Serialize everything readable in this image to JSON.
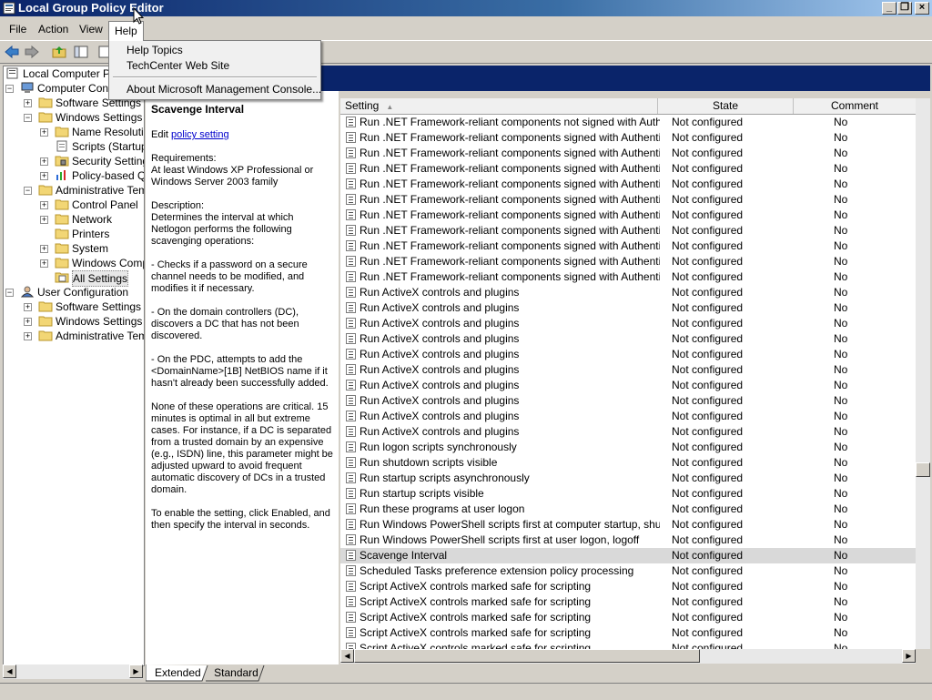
{
  "window": {
    "title": "Local Group Policy Editor"
  },
  "menubar": [
    {
      "label": "File"
    },
    {
      "label": "Action"
    },
    {
      "label": "View"
    },
    {
      "label": "Help"
    }
  ],
  "help_menu": {
    "items": [
      "Help Topics",
      "TechCenter Web Site"
    ],
    "about": "About Microsoft Management Console..."
  },
  "tree": [
    {
      "label": "Local Computer Poli",
      "level": 0,
      "expander": "",
      "icon": "policy-icon"
    },
    {
      "label": "Computer Config",
      "level": 1,
      "expander": "-",
      "icon": "computer-icon"
    },
    {
      "label": "Software Settings",
      "level": 2,
      "expander": "+",
      "icon": "folder-icon"
    },
    {
      "label": "Windows Settings",
      "level": 2,
      "expander": "-",
      "icon": "folder-icon"
    },
    {
      "label": "Name Resolutio",
      "level": 3,
      "expander": "+",
      "icon": "folder-icon"
    },
    {
      "label": "Scripts (Startup",
      "level": 3,
      "expander": "",
      "icon": "script-icon"
    },
    {
      "label": "Security Setting",
      "level": 3,
      "expander": "+",
      "icon": "security-icon"
    },
    {
      "label": "Policy-based Q",
      "level": 3,
      "expander": "+",
      "icon": "chart-icon"
    },
    {
      "label": "Administrative Temp",
      "level": 2,
      "expander": "-",
      "icon": "folder-icon"
    },
    {
      "label": "Control Panel",
      "level": 3,
      "expander": "+",
      "icon": "folder-icon"
    },
    {
      "label": "Network",
      "level": 3,
      "expander": "+",
      "icon": "folder-icon"
    },
    {
      "label": "Printers",
      "level": 3,
      "expander": "",
      "icon": "folder-icon"
    },
    {
      "label": "System",
      "level": 3,
      "expander": "+",
      "icon": "folder-icon"
    },
    {
      "label": "Windows Comp",
      "level": 3,
      "expander": "+",
      "icon": "folder-icon"
    },
    {
      "label": "All Settings",
      "level": 3,
      "expander": "",
      "icon": "settings-icon",
      "selected": true
    },
    {
      "label": "User Configuration",
      "level": 1,
      "expander": "-",
      "icon": "user-icon"
    },
    {
      "label": "Software Settings",
      "level": 2,
      "expander": "+",
      "icon": "folder-icon"
    },
    {
      "label": "Windows Settings",
      "level": 2,
      "expander": "+",
      "icon": "folder-icon"
    },
    {
      "label": "Administrative Temp",
      "level": 2,
      "expander": "+",
      "icon": "folder-icon"
    }
  ],
  "description": {
    "title": "Scavenge Interval",
    "edit_prefix": "Edit ",
    "edit_link": "policy setting",
    "requirements": "Requirements:\nAt least Windows XP Professional or Windows Server 2003 family",
    "body": "Description:\nDetermines the interval at which Netlogon performs the following scavenging operations:\n\n- Checks if a password on a secure channel needs to be modified, and modifies it if necessary.\n\n- On the domain controllers (DC), discovers a DC that has not been discovered.\n\n- On the PDC, attempts to add the <DomainName>[1B] NetBIOS name if it hasn't already been successfully added.\n\nNone of these operations are critical. 15 minutes is optimal in all but extreme cases. For instance, if a DC is separated from a trusted domain by an expensive (e.g., ISDN) line, this parameter might be adjusted upward to avoid frequent automatic discovery of DCs in a trusted domain.\n\nTo enable the setting, click Enabled, and then specify the interval in seconds."
  },
  "list": {
    "columns": {
      "setting": "Setting",
      "state": "State",
      "comment": "Comment"
    },
    "rows": [
      [
        "Run .NET Framework-reliant components not signed with Authentic...",
        "Not configured",
        "No"
      ],
      [
        "Run .NET Framework-reliant components signed with Authenticode",
        "Not configured",
        "No"
      ],
      [
        "Run .NET Framework-reliant components signed with Authenticode",
        "Not configured",
        "No"
      ],
      [
        "Run .NET Framework-reliant components signed with Authenticode",
        "Not configured",
        "No"
      ],
      [
        "Run .NET Framework-reliant components signed with Authenticode",
        "Not configured",
        "No"
      ],
      [
        "Run .NET Framework-reliant components signed with Authenticode",
        "Not configured",
        "No"
      ],
      [
        "Run .NET Framework-reliant components signed with Authenticode",
        "Not configured",
        "No"
      ],
      [
        "Run .NET Framework-reliant components signed with Authenticode",
        "Not configured",
        "No"
      ],
      [
        "Run .NET Framework-reliant components signed with Authenticode",
        "Not configured",
        "No"
      ],
      [
        "Run .NET Framework-reliant components signed with Authenticode",
        "Not configured",
        "No"
      ],
      [
        "Run .NET Framework-reliant components signed with Authenticode",
        "Not configured",
        "No"
      ],
      [
        "Run ActiveX controls and plugins",
        "Not configured",
        "No"
      ],
      [
        "Run ActiveX controls and plugins",
        "Not configured",
        "No"
      ],
      [
        "Run ActiveX controls and plugins",
        "Not configured",
        "No"
      ],
      [
        "Run ActiveX controls and plugins",
        "Not configured",
        "No"
      ],
      [
        "Run ActiveX controls and plugins",
        "Not configured",
        "No"
      ],
      [
        "Run ActiveX controls and plugins",
        "Not configured",
        "No"
      ],
      [
        "Run ActiveX controls and plugins",
        "Not configured",
        "No"
      ],
      [
        "Run ActiveX controls and plugins",
        "Not configured",
        "No"
      ],
      [
        "Run ActiveX controls and plugins",
        "Not configured",
        "No"
      ],
      [
        "Run ActiveX controls and plugins",
        "Not configured",
        "No"
      ],
      [
        "Run logon scripts synchronously",
        "Not configured",
        "No"
      ],
      [
        "Run shutdown scripts visible",
        "Not configured",
        "No"
      ],
      [
        "Run startup scripts asynchronously",
        "Not configured",
        "No"
      ],
      [
        "Run startup scripts visible",
        "Not configured",
        "No"
      ],
      [
        "Run these programs at user logon",
        "Not configured",
        "No"
      ],
      [
        "Run Windows PowerShell scripts first at computer startup, shutdown",
        "Not configured",
        "No"
      ],
      [
        "Run Windows PowerShell scripts first at user logon, logoff",
        "Not configured",
        "No"
      ],
      [
        "Scavenge Interval",
        "Not configured",
        "No"
      ],
      [
        "Scheduled Tasks preference extension policy processing",
        "Not configured",
        "No"
      ],
      [
        "Script ActiveX controls marked safe for scripting",
        "Not configured",
        "No"
      ],
      [
        "Script ActiveX controls marked safe for scripting",
        "Not configured",
        "No"
      ],
      [
        "Script ActiveX controls marked safe for scripting",
        "Not configured",
        "No"
      ],
      [
        "Script ActiveX controls marked safe for scripting",
        "Not configured",
        "No"
      ],
      [
        "Script ActiveX controls marked safe for scripting",
        "Not configured",
        "No"
      ]
    ],
    "selected_index": 28
  },
  "tabs": [
    "Extended",
    "Standard"
  ],
  "colors": {
    "header_blue": "#0a246a",
    "link": "#0000cc",
    "selection": "#d9d9d9"
  }
}
